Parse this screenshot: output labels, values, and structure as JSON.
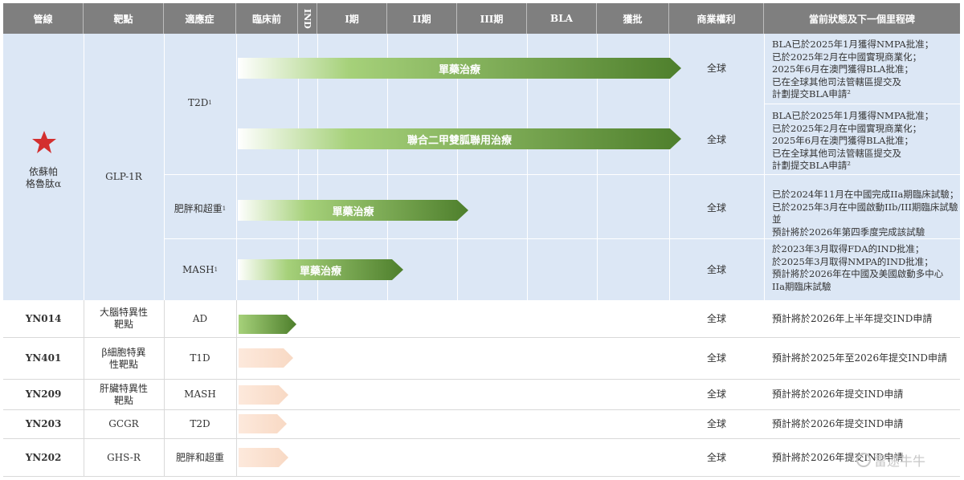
{
  "header": {
    "pipeline": "管線",
    "target": "靶點",
    "indication": "適應症",
    "preclinical": "臨床前",
    "ind": "IND",
    "phase1": "I期",
    "phase2": "II期",
    "phase3": "III期",
    "bla": "BLA",
    "approval": "獲批",
    "rights": "商業權利",
    "status": "當前狀態及下一個里程碑"
  },
  "lead": {
    "name_line1": "依蘇帕",
    "name_line2": "格魯肽α",
    "target": "GLP-1R",
    "indications": [
      {
        "name": "T2D",
        "sup": "1"
      },
      {
        "name": "肥胖和超重",
        "sup": "1"
      },
      {
        "name": "MASH",
        "sup": "1"
      }
    ],
    "rows": [
      {
        "bar_label": "單藥治療",
        "progress_stage": "approval",
        "rights": "全球",
        "status": [
          "BLA已於2025年1月獲得NMPA批准；",
          "已於2025年2月在中國實現商業化；",
          "2025年6月在澳門獲得BLA批准；",
          "已在全球其他司法管轄區提交及",
          "計劃提交BLA申請²"
        ]
      },
      {
        "bar_label": "聯合二甲雙胍聯用治療",
        "progress_stage": "approval",
        "rights": "全球",
        "status": [
          "BLA已於2025年1月獲得NMPA批准；",
          "已於2025年2月在中國實現商業化；",
          "2025年6月在澳門獲得BLA批准；",
          "已在全球其他司法管轄區提交及",
          "計劃提交BLA申請²"
        ]
      },
      {
        "bar_label": "單藥治療",
        "progress_stage": "phase3",
        "rights": "全球",
        "status": [
          "已於2024年11月在中國完成IIa期臨床試驗；",
          "已於2025年3月在中國啟動IIb/III期臨床試驗並",
          "預計將於2026年第四季度完成該試驗"
        ]
      },
      {
        "bar_label": "單藥治療",
        "progress_stage": "phase2",
        "rights": "全球",
        "status": [
          "於2023年3月取得FDA的IND批准；",
          "於2025年3月取得NMPA的IND批准；",
          "預計將於2026年在中國及美國啟動多中心",
          "IIa期臨床試驗"
        ]
      }
    ]
  },
  "others": [
    {
      "pipeline": "YN014",
      "target": [
        "大腦特異性",
        "靶點"
      ],
      "indication": "AD",
      "bar_style": "green",
      "rights": "全球",
      "status": "預計將於2026年上半年提交IND申請"
    },
    {
      "pipeline": "YN401",
      "target": [
        "β細胞特異",
        "性靶點"
      ],
      "indication": "T1D",
      "bar_style": "peach",
      "rights": "全球",
      "status": "預計將於2025年至2026年提交IND申請"
    },
    {
      "pipeline": "YN209",
      "target": [
        "肝臟特異性",
        "靶點"
      ],
      "indication": "MASH",
      "bar_style": "peach",
      "rights": "全球",
      "status": "預計將於2026年提交IND申請"
    },
    {
      "pipeline": "YN203",
      "target": [
        "GCGR"
      ],
      "indication": "T2D",
      "bar_style": "peach",
      "rights": "全球",
      "status": "預計將於2026年提交IND申請"
    },
    {
      "pipeline": "YN202",
      "target": [
        "GHS-R"
      ],
      "indication": "肥胖和超重",
      "bar_style": "peach",
      "rights": "全球",
      "status": "預計將於2026年提交IND申請"
    }
  ],
  "watermark": "雷途牛牛",
  "colors": {
    "header": "#7f7f7f",
    "lead_bg": "#dce7f5",
    "green_dark": "#4e7f2c",
    "green_light": "#a6d17a",
    "peach": "#f8d9c4",
    "star": "#d32f2f"
  }
}
